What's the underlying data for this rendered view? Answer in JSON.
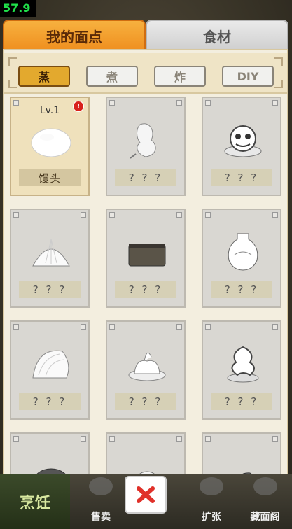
{
  "fps": "57.9",
  "tabs": {
    "active": "我的面点",
    "inactive": "食材"
  },
  "filters": [
    "蒸",
    "煮",
    "炸",
    "DIY"
  ],
  "active_filter": "蒸",
  "unlocked": {
    "level": "Lv.1",
    "name": "馒头",
    "badge": "!"
  },
  "locked_label": "? ? ?",
  "icons": [
    "steamed-bun",
    "radish",
    "lion-dance-dumpling",
    "baozi",
    "sponge-cake",
    "vase-dumpling",
    "shell-dumpling",
    "swirl-bun",
    "dragon-bun",
    "round-bun",
    "rose-bun",
    "fish-bun"
  ],
  "nav": {
    "cook": "烹饪",
    "sell": "售卖",
    "expand": "扩张",
    "collection": "藏面阁"
  },
  "colors": {
    "accent": "#ef8f1f",
    "close": "#e0312a"
  }
}
